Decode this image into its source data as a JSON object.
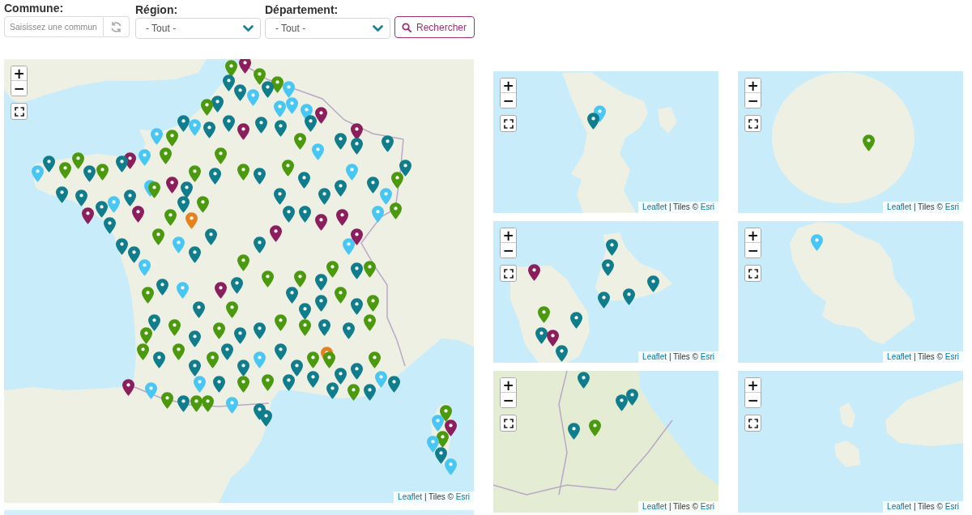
{
  "filters": {
    "fields": [
      {
        "kind": "text",
        "label": "Commune:",
        "placeholder": "Saisissez une commun"
      },
      {
        "kind": "select",
        "label": "Région:",
        "value": "- Tout -"
      },
      {
        "kind": "select",
        "label": "Département:",
        "value": "- Tout -"
      }
    ],
    "search_button": "Rechercher"
  },
  "maps": [
    {
      "kind": "france",
      "zoom_in": "+",
      "zoom_out": "−",
      "attribution": {
        "link": "Leaflet",
        "text": "| Tiles ©",
        "source": "Esri"
      },
      "markers": [
        {
          "color": "#4b9a0e"
        },
        {
          "color": "#8d1e5e"
        },
        {
          "color": "#4b9a0e"
        },
        {
          "color": "#4b9a0e"
        },
        {
          "color": "#48c7f4"
        },
        {
          "color": "#0f7d8c"
        },
        {
          "color": "#0f7d8c"
        },
        {
          "color": "#48c7f4"
        },
        {
          "color": "#0f7d8c"
        },
        {
          "color": "#48c7f4"
        },
        {
          "color": "#48c7f4"
        },
        {
          "color": "#48c7f4"
        },
        {
          "color": "#4b9a0e"
        },
        {
          "color": "#0f7d8c"
        },
        {
          "color": "#48c7f4"
        },
        {
          "color": "#0f7d8c"
        },
        {
          "color": "#4b9a0e"
        },
        {
          "color": "#48c7f4"
        },
        {
          "color": "#0f7d8c"
        },
        {
          "color": "#0f7d8c"
        },
        {
          "color": "#8d1e5e"
        },
        {
          "color": "#0f7d8c"
        },
        {
          "color": "#0f7d8c"
        },
        {
          "color": "#8d1e5e"
        },
        {
          "color": "#0f7d8c"
        },
        {
          "color": "#4b9a0e"
        },
        {
          "color": "#48c7f4"
        },
        {
          "color": "#0f7d8c"
        },
        {
          "color": "#8d1e5e"
        },
        {
          "color": "#0f7d8c"
        },
        {
          "color": "#0f7d8c"
        },
        {
          "color": "#0f7d8c"
        },
        {
          "color": "#4b9a0e"
        },
        {
          "color": "#48c7f4"
        },
        {
          "color": "#4b9a0e"
        },
        {
          "color": "#48c7f4"
        },
        {
          "color": "#0f7d8c"
        },
        {
          "color": "#48c7f4"
        },
        {
          "color": "#0f7d8c"
        },
        {
          "color": "#0f7d8c"
        },
        {
          "color": "#0f7d8c"
        },
        {
          "color": "#4b9a0e"
        },
        {
          "color": "#0f7d8c"
        },
        {
          "color": "#0f7d8c"
        },
        {
          "color": "#4b9a0e"
        },
        {
          "color": "#4b9a0e"
        },
        {
          "color": "#0f7d8c"
        },
        {
          "color": "#4b9a0e"
        },
        {
          "color": "#0f7d8c"
        },
        {
          "color": "#8d1e5e"
        },
        {
          "color": "#4b9a0e"
        },
        {
          "color": "#48c7f4"
        },
        {
          "color": "#0f7d8c"
        },
        {
          "color": "#4b9a0e"
        },
        {
          "color": "#4b9a0e"
        },
        {
          "color": "#0f7d8c"
        },
        {
          "color": "#4b9a0e"
        },
        {
          "color": "#0f7d8c"
        },
        {
          "color": "#8d1e5e"
        },
        {
          "color": "#48c7f4"
        },
        {
          "color": "#4b9a0e"
        },
        {
          "color": "#0f7d8c"
        },
        {
          "color": "#0f7d8c"
        },
        {
          "color": "#8d1e5e"
        },
        {
          "color": "#0f7d8c"
        },
        {
          "color": "#48c7f4"
        },
        {
          "color": "#0f7d8c"
        },
        {
          "color": "#8d1e5e"
        },
        {
          "color": "#48c7f4"
        },
        {
          "color": "#0f7d8c"
        },
        {
          "color": "#0f7d8c"
        },
        {
          "color": "#48c7f4"
        },
        {
          "color": "#0f7d8c"
        },
        {
          "color": "#4b9a0e"
        },
        {
          "color": "#4b9a0e"
        },
        {
          "color": "#0f7d8c"
        },
        {
          "color": "#4b9a0e"
        },
        {
          "color": "#48c7f4"
        },
        {
          "color": "#0f7d8c"
        },
        {
          "color": "#0f7d8c"
        },
        {
          "color": "#4b9a0e"
        },
        {
          "color": "#0f7d8c"
        },
        {
          "color": "#48c7f4"
        },
        {
          "color": "#0f7d8c"
        },
        {
          "color": "#8d1e5e"
        },
        {
          "color": "#0f7d8c"
        },
        {
          "color": "#4b9a0e"
        },
        {
          "color": "#4b9a0e"
        },
        {
          "color": "#4b9a0e"
        },
        {
          "color": "#0f7d8c"
        },
        {
          "color": "#8d1e5e"
        },
        {
          "color": "#0f7d8c"
        },
        {
          "color": "#0f7d8c"
        },
        {
          "color": "#8d1e5e"
        },
        {
          "color": "#8d1e5e"
        },
        {
          "color": "#8d1e5e"
        },
        {
          "color": "#48c7f4"
        },
        {
          "color": "#4b9a0e"
        },
        {
          "color": "#0f7d8c"
        },
        {
          "color": "#4b9a0e"
        },
        {
          "color": "#0f7d8c"
        },
        {
          "color": "#4b9a0e"
        },
        {
          "color": "#0f7d8c"
        },
        {
          "color": "#0f7d8c"
        },
        {
          "color": "#0f7d8c"
        },
        {
          "color": "#4b9a0e"
        },
        {
          "color": "#0f7d8c"
        },
        {
          "color": "#4b9a0e"
        },
        {
          "color": "#4b9a0e"
        },
        {
          "color": "#0f7d8c"
        },
        {
          "color": "#0f7d8c"
        },
        {
          "color": "#4b9a0e"
        },
        {
          "color": "#4b9a0e"
        },
        {
          "color": "#0f7d8c"
        },
        {
          "color": "#0f7d8c"
        },
        {
          "color": "#4b9a0e"
        },
        {
          "color": "#0f7d8c"
        },
        {
          "color": "#4b9a0e"
        },
        {
          "color": "#0f7d8c"
        },
        {
          "color": "#4b9a0e"
        },
        {
          "color": "#4b9a0e"
        },
        {
          "color": "#0f7d8c"
        },
        {
          "color": "#4b9a0e"
        },
        {
          "color": "#0f7d8c"
        },
        {
          "color": "#4b9a0e"
        },
        {
          "color": "#0f7d8c"
        },
        {
          "color": "#0f7d8c"
        },
        {
          "color": "#48c7f4"
        },
        {
          "color": "#0f7d8c"
        },
        {
          "color": "#0f7d8c"
        },
        {
          "color": "#4b9a0e"
        },
        {
          "color": "#4b9a0e"
        },
        {
          "color": "#0f7d8c"
        },
        {
          "color": "#0f7d8c"
        },
        {
          "color": "#4b9a0e"
        },
        {
          "color": "#48c7f4"
        },
        {
          "color": "#0f7d8c"
        },
        {
          "color": "#0f7d8c"
        },
        {
          "color": "#4b9a0e"
        },
        {
          "color": "#0f7d8c"
        },
        {
          "color": "#0f7d8c"
        },
        {
          "color": "#0f7d8c"
        },
        {
          "color": "#4b9a0e"
        },
        {
          "color": "#4b9a0e"
        },
        {
          "color": "#0f7d8c"
        },
        {
          "color": "#48c7f4"
        },
        {
          "color": "#0f7d8c"
        },
        {
          "color": "#4b9a0e"
        },
        {
          "color": "#48c7f4"
        },
        {
          "color": "#8d1e5e"
        },
        {
          "color": "#4b9a0e"
        },
        {
          "color": "#48c7f4"
        },
        {
          "color": "#0f7d8c"
        },
        {
          "color": "#0f7d8c"
        },
        {
          "color": "#4b9a0e"
        },
        {
          "color": "#48c7f4"
        },
        {
          "color": "#4b9a0e"
        },
        {
          "color": "#8d1e5e"
        },
        {
          "color": "#4b9a0e"
        },
        {
          "color": "#48c7f4"
        },
        {
          "color": "#0f7d8c"
        },
        {
          "color": "#48c7f4"
        },
        {
          "color": "#e5821b"
        },
        {
          "color": "#e5821b"
        }
      ]
    },
    {
      "kind": "mayotte",
      "zoom_in": "+",
      "zoom_out": "−",
      "attribution": {
        "link": "Leaflet",
        "text": "| Tiles ©",
        "source": "Esri"
      },
      "markers": [
        {
          "color": "#48c7f4"
        },
        {
          "color": "#0f7d8c"
        }
      ]
    },
    {
      "kind": "reunion",
      "zoom_in": "+",
      "zoom_out": "−",
      "attribution": {
        "link": "Leaflet",
        "text": "| Tiles ©",
        "source": "Esri"
      },
      "markers": [
        {
          "color": "#4b9a0e"
        }
      ]
    },
    {
      "kind": "guadeloupe",
      "zoom_in": "+",
      "zoom_out": "−",
      "attribution": {
        "link": "Leaflet",
        "text": "| Tiles ©",
        "source": "Esri"
      },
      "markers": [
        {
          "color": "#0f7d8c"
        },
        {
          "color": "#0f7d8c"
        },
        {
          "color": "#8d1e5e"
        },
        {
          "color": "#0f7d8c"
        },
        {
          "color": "#0f7d8c"
        },
        {
          "color": "#0f7d8c"
        },
        {
          "color": "#4b9a0e"
        },
        {
          "color": "#0f7d8c"
        },
        {
          "color": "#0f7d8c"
        },
        {
          "color": "#8d1e5e"
        },
        {
          "color": "#0f7d8c"
        }
      ]
    },
    {
      "kind": "martinique",
      "zoom_in": "+",
      "zoom_out": "−",
      "attribution": {
        "link": "Leaflet",
        "text": "| Tiles ©",
        "source": "Esri"
      },
      "markers": [
        {
          "color": "#48c7f4"
        }
      ]
    },
    {
      "kind": "guiana",
      "zoom_in": "+",
      "zoom_out": "−",
      "attribution": {
        "link": "Leaflet",
        "text": "| Tiles ©",
        "source": "Esri"
      },
      "markers": [
        {
          "color": "#0f7d8c"
        },
        {
          "color": "#0f7d8c"
        },
        {
          "color": "#0f7d8c"
        },
        {
          "color": "#0f7d8c"
        },
        {
          "color": "#4b9a0e"
        }
      ]
    },
    {
      "kind": "saint_pierre",
      "zoom_in": "+",
      "zoom_out": "−",
      "attribution": {
        "link": "Leaflet",
        "text": "| Tiles ©",
        "source": "Esri"
      }
    }
  ]
}
